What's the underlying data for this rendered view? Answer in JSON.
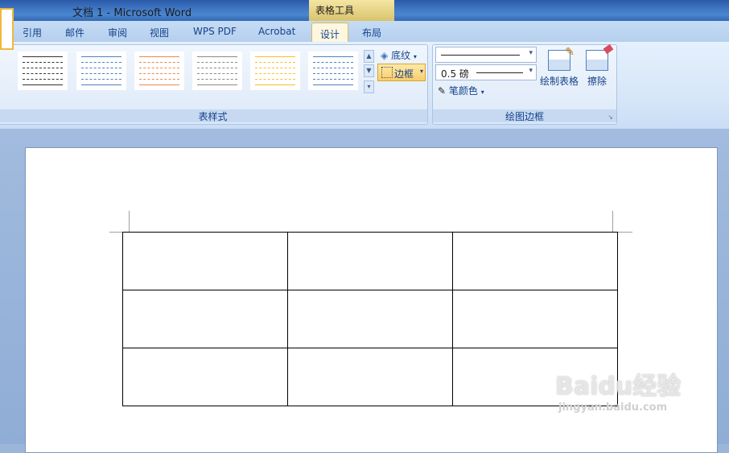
{
  "window": {
    "title": "文档 1 - Microsoft Word",
    "context_group": "表格工具"
  },
  "tabs": [
    {
      "label": "引用"
    },
    {
      "label": "邮件"
    },
    {
      "label": "审阅"
    },
    {
      "label": "视图"
    },
    {
      "label": "WPS PDF"
    },
    {
      "label": "Acrobat"
    },
    {
      "label": "设计"
    },
    {
      "label": "布局"
    }
  ],
  "active_tab": "设计",
  "ribbon": {
    "table_styles": {
      "label": "表样式",
      "shading_label": "底纹",
      "borders_label": "边框",
      "swatch_colors": [
        "#333333",
        "#4f81bd",
        "#e88a50",
        "#8a8a8a",
        "#f2c12e",
        "#4f81bd"
      ]
    },
    "draw_borders": {
      "label": "绘图边框",
      "line_weight": "0.5 磅",
      "pen_color_label": "笔颜色",
      "draw_table_label": "绘制表格",
      "eraser_label": "擦除"
    }
  },
  "watermark": {
    "brand": "Baidu经验",
    "url": "jingyan.baidu.com"
  }
}
